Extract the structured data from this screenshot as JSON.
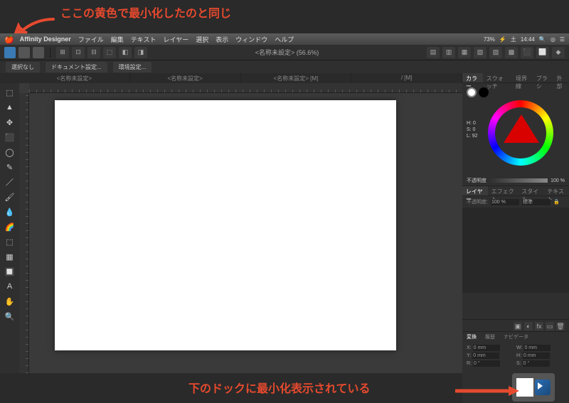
{
  "annotations": {
    "top": "ここの黄色で最小化したのと同じ",
    "bottom": "下のドックに最小化表示されている"
  },
  "menubar": {
    "app": "Affinity Designer",
    "items": [
      "ファイル",
      "編集",
      "テキスト",
      "レイヤー",
      "選択",
      "表示",
      "ウィンドウ",
      "ヘルプ"
    ],
    "battery": "73%",
    "day": "土",
    "time": "14:44"
  },
  "toolbar": {
    "title": "<名称未設定> (56.6%)"
  },
  "contextbar": {
    "selection": "選択なし",
    "docset": "ドキュメント設定...",
    "envset": "環境設定..."
  },
  "doctabs": [
    "<名称未設定>",
    "<名称未設定>",
    "<名称未設定> [M]",
    "/ [M]"
  ],
  "tools": [
    "⬚",
    "▲",
    "✥",
    "⬛",
    "◯",
    "✎",
    "／",
    "🖌",
    "💧",
    "🌈",
    "⬚",
    "▦",
    "🔲",
    "A",
    "✋",
    "🔍"
  ],
  "rpanel": {
    "tabs": [
      "カラー",
      "スウォッチ",
      "境界線",
      "ブラシ",
      "外部"
    ],
    "hsl": {
      "h": "H: 0",
      "s": "S: 0",
      "l": "L: 92"
    },
    "opacity_label": "不透明度",
    "opacity_value": "100 %",
    "layer_tabs": [
      "レイヤー",
      "エフェクト",
      "スタイル",
      "テキスト"
    ],
    "layer_opacity_label": "不透明度:",
    "layer_opacity_value": "100 %",
    "layer_blend": "標準"
  },
  "transform": {
    "tabs": [
      "変換",
      "履歴",
      "ナビゲータ"
    ],
    "x_label": "X:",
    "x": "0 mm",
    "y_label": "Y:",
    "y": "0 mm",
    "w_label": "W:",
    "w": "0 mm",
    "h_label": "H:",
    "h": "0 mm",
    "r_label": "R:",
    "r": "0 °",
    "s_label": "S:",
    "s": "0 °"
  }
}
